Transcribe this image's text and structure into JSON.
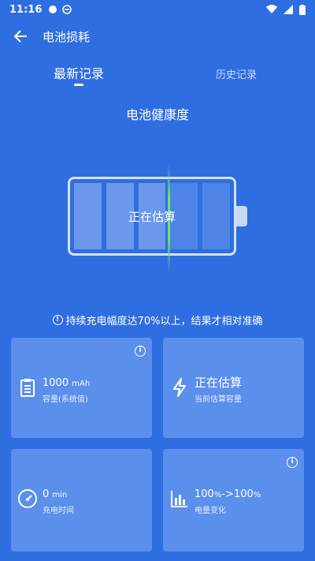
{
  "status_bar": {
    "time": "11:16"
  },
  "app_bar": {
    "title": "电池损耗"
  },
  "tabs": {
    "latest": "最新记录",
    "history": "历史记录"
  },
  "section_title": "电池健康度",
  "battery": {
    "status_text": "正在估算"
  },
  "notice": "持续充电幅度达70%以上，结果才相对准确",
  "cards": {
    "capacity": {
      "value": "1000",
      "unit": "mAh",
      "label": "容量(系统值)"
    },
    "estimate": {
      "value": "正在估算",
      "label": "当前估算容量"
    },
    "charge_time": {
      "value": "0",
      "unit": "min",
      "label": "充电时间"
    },
    "level_change": {
      "value_start": "100",
      "value_end": "100",
      "unit": "%",
      "arrow": "->",
      "label": "电量变化"
    }
  },
  "colors": {
    "background": "#2f6ee0",
    "card": "#5a8fec",
    "scan_line": "#6fe06f"
  }
}
